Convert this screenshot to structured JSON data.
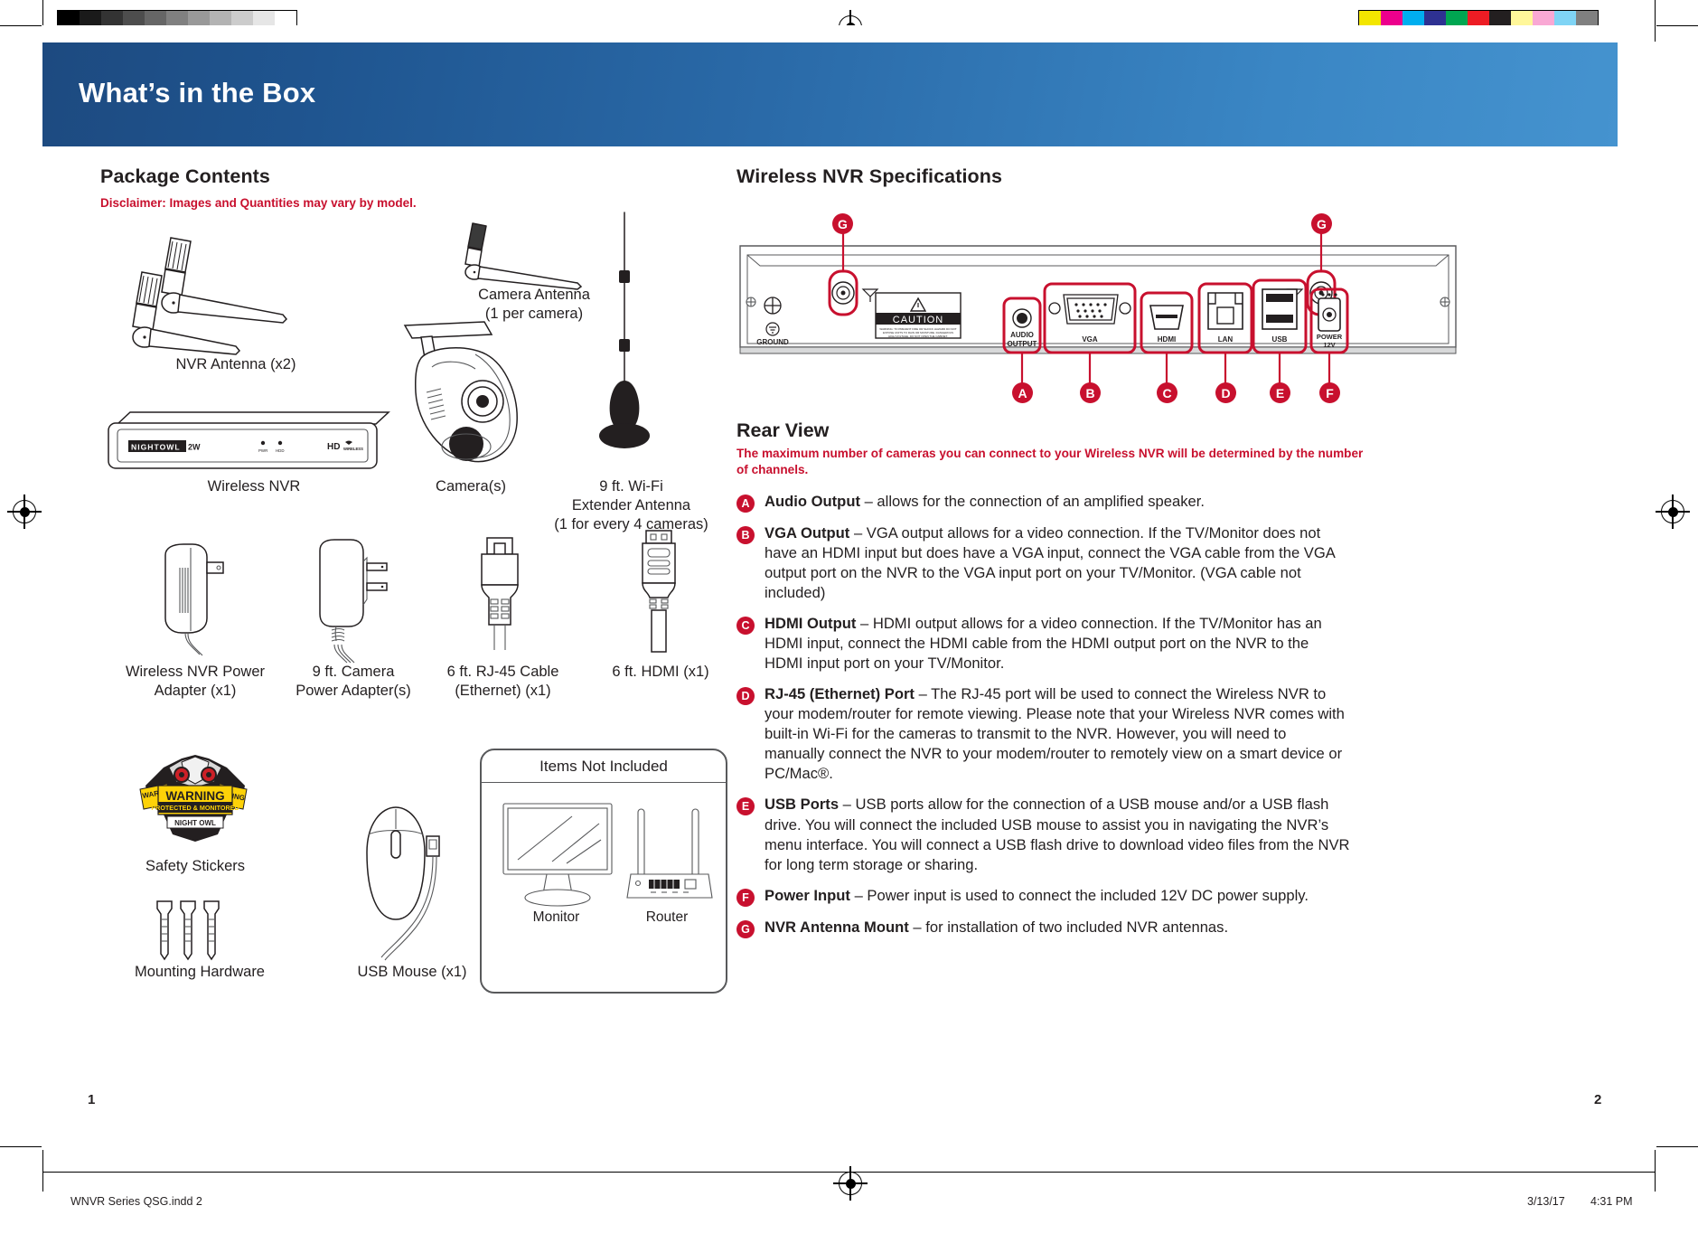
{
  "document": {
    "header_title": "What’s in the Box",
    "page_left_number": "1",
    "page_right_number": "2",
    "footer_filename": "WNVR Series QSG.indd   2",
    "footer_date": "3/13/17",
    "footer_time": "4:31 PM"
  },
  "package": {
    "heading": "Package Contents",
    "disclaimer": "Disclaimer: Images and Quantities may vary by model.",
    "items": [
      {
        "label": "NVR Antenna (x2)"
      },
      {
        "label": "Camera Antenna\n(1 per camera)",
        "line1": "Camera Antenna",
        "line2": "(1 per camera)"
      },
      {
        "label": "Wireless NVR"
      },
      {
        "label": "Camera(s)"
      },
      {
        "line1": "9 ft. Wi-Fi",
        "line2": "Extender Antenna",
        "line3": "(1 for every 4 cameras)"
      },
      {
        "line1": "Wireless NVR Power",
        "line2": "Adapter (x1)"
      },
      {
        "line1": "9 ft. Camera",
        "line2": "Power Adapter(s)"
      },
      {
        "line1": "6 ft. RJ-45 Cable",
        "line2": "(Ethernet) (x1)"
      },
      {
        "line1": "6 ft. HDMI (x1)"
      },
      {
        "label": "Safety Stickers"
      },
      {
        "label": "Mounting Hardware"
      },
      {
        "label": "USB Mouse (x1)"
      }
    ],
    "nvr_brand": "NIGHT OWL",
    "nvr_brand_suffix": "2W",
    "nvr_led_pwr": "PWR",
    "nvr_led_hdd": "HDD",
    "nvr_hd_badge": "HD",
    "nvr_hd_badge_sub": "WIRELESS",
    "sticker": {
      "warning": "WARNING",
      "subtitle": "PROTECTED & MONITORED",
      "brand": "NIGHT OWL"
    },
    "not_included": {
      "title": "Items Not Included",
      "items": [
        "Monitor",
        "Router"
      ]
    }
  },
  "specs": {
    "heading": "Wireless NVR Specifications",
    "rear_view_title": "Rear View",
    "rear_view_warning": "The maximum number of cameras you can connect to your Wireless NVR will be determined by the number of channels.",
    "diagram": {
      "caution_label": "CAUTION",
      "caution_body": "WARNING: TO PREVENT FIRE OR SHOCK HAZARD DO NOT EXPOSE UNITS TO RAIN OR MOISTURE. DANGEROUS HIGH VOLTAGE. DO NOT OPEN THE CABINET.",
      "ground_label": "GROUND",
      "ports": [
        {
          "letter": "A",
          "port_label": "AUDIO\nOUTPUT",
          "l1": "AUDIO",
          "l2": "OUTPUT"
        },
        {
          "letter": "B",
          "port_label": "VGA",
          "l1": "VGA",
          "l2": ""
        },
        {
          "letter": "C",
          "port_label": "HDMI",
          "l1": "HDMI",
          "l2": ""
        },
        {
          "letter": "D",
          "port_label": "LAN",
          "l1": "LAN",
          "l2": ""
        },
        {
          "letter": "E",
          "port_label": "USB",
          "l1": "USB",
          "l2": ""
        },
        {
          "letter": "F",
          "port_label": "POWER\n12V",
          "l1": "POWER",
          "l2": "12V"
        }
      ],
      "antenna_mount_letter": "G"
    },
    "items": [
      {
        "letter": "A",
        "title": "Audio Output",
        "body": " – allows for the connection of an amplified speaker."
      },
      {
        "letter": "B",
        "title": "VGA Output",
        "body": " – VGA output allows for a video connection. If the TV/Monitor does not have an HDMI input but does have a VGA input, connect the VGA cable from the VGA output port on the NVR to the VGA input port on your TV/Monitor. (VGA cable not included)"
      },
      {
        "letter": "C",
        "title": "HDMI Output",
        "body": " – HDMI output allows for a video connection. If the TV/Monitor has an HDMI input, connect the HDMI cable from the HDMI output port on the NVR to the HDMI input port on your TV/Monitor."
      },
      {
        "letter": "D",
        "title": "RJ-45 (Ethernet) Port",
        "body": " – The RJ-45 port will be used to connect the Wireless NVR to your modem/router for remote viewing. Please note that your Wireless NVR comes with built-in Wi-Fi for the cameras to transmit to the NVR. However, you will need to manually connect the NVR to your modem/router to remotely view on a smart device or PC/Mac®."
      },
      {
        "letter": "E",
        "title": "USB Ports",
        "body": " – USB ports allow for the connection of a USB mouse and/or a USB flash drive. You will connect the included USB mouse to assist you in navigating the NVR’s menu interface. You will connect a USB flash drive to download video files from the NVR for long term storage or sharing."
      },
      {
        "letter": "F",
        "title": "Power Input",
        "body": " – Power input is used to connect the included 12V DC power supply."
      },
      {
        "letter": "G",
        "title": "NVR Antenna Mount",
        "body": " – for installation of two included NVR antennas."
      }
    ]
  },
  "colors": {
    "accent_red": "#c8102e",
    "header_blue_dark": "#1d4a80",
    "header_blue_light": "#4593cf",
    "ink": "#231f20",
    "sticker_yellow": "#fdd208"
  },
  "print_marks": {
    "grayscale_swatches": [
      "#000000",
      "#1a1a1a",
      "#333333",
      "#4d4d4d",
      "#666666",
      "#808080",
      "#999999",
      "#b3b3b3",
      "#cccccc",
      "#e6e6e6",
      "#ffffff"
    ],
    "color_swatches": [
      "#f3e600",
      "#ec008c",
      "#00aeef",
      "#2e3192",
      "#00a651",
      "#ed1c24",
      "#231f20",
      "#fff79a",
      "#f9a8d4",
      "#7fd4f5",
      "#808080"
    ]
  }
}
